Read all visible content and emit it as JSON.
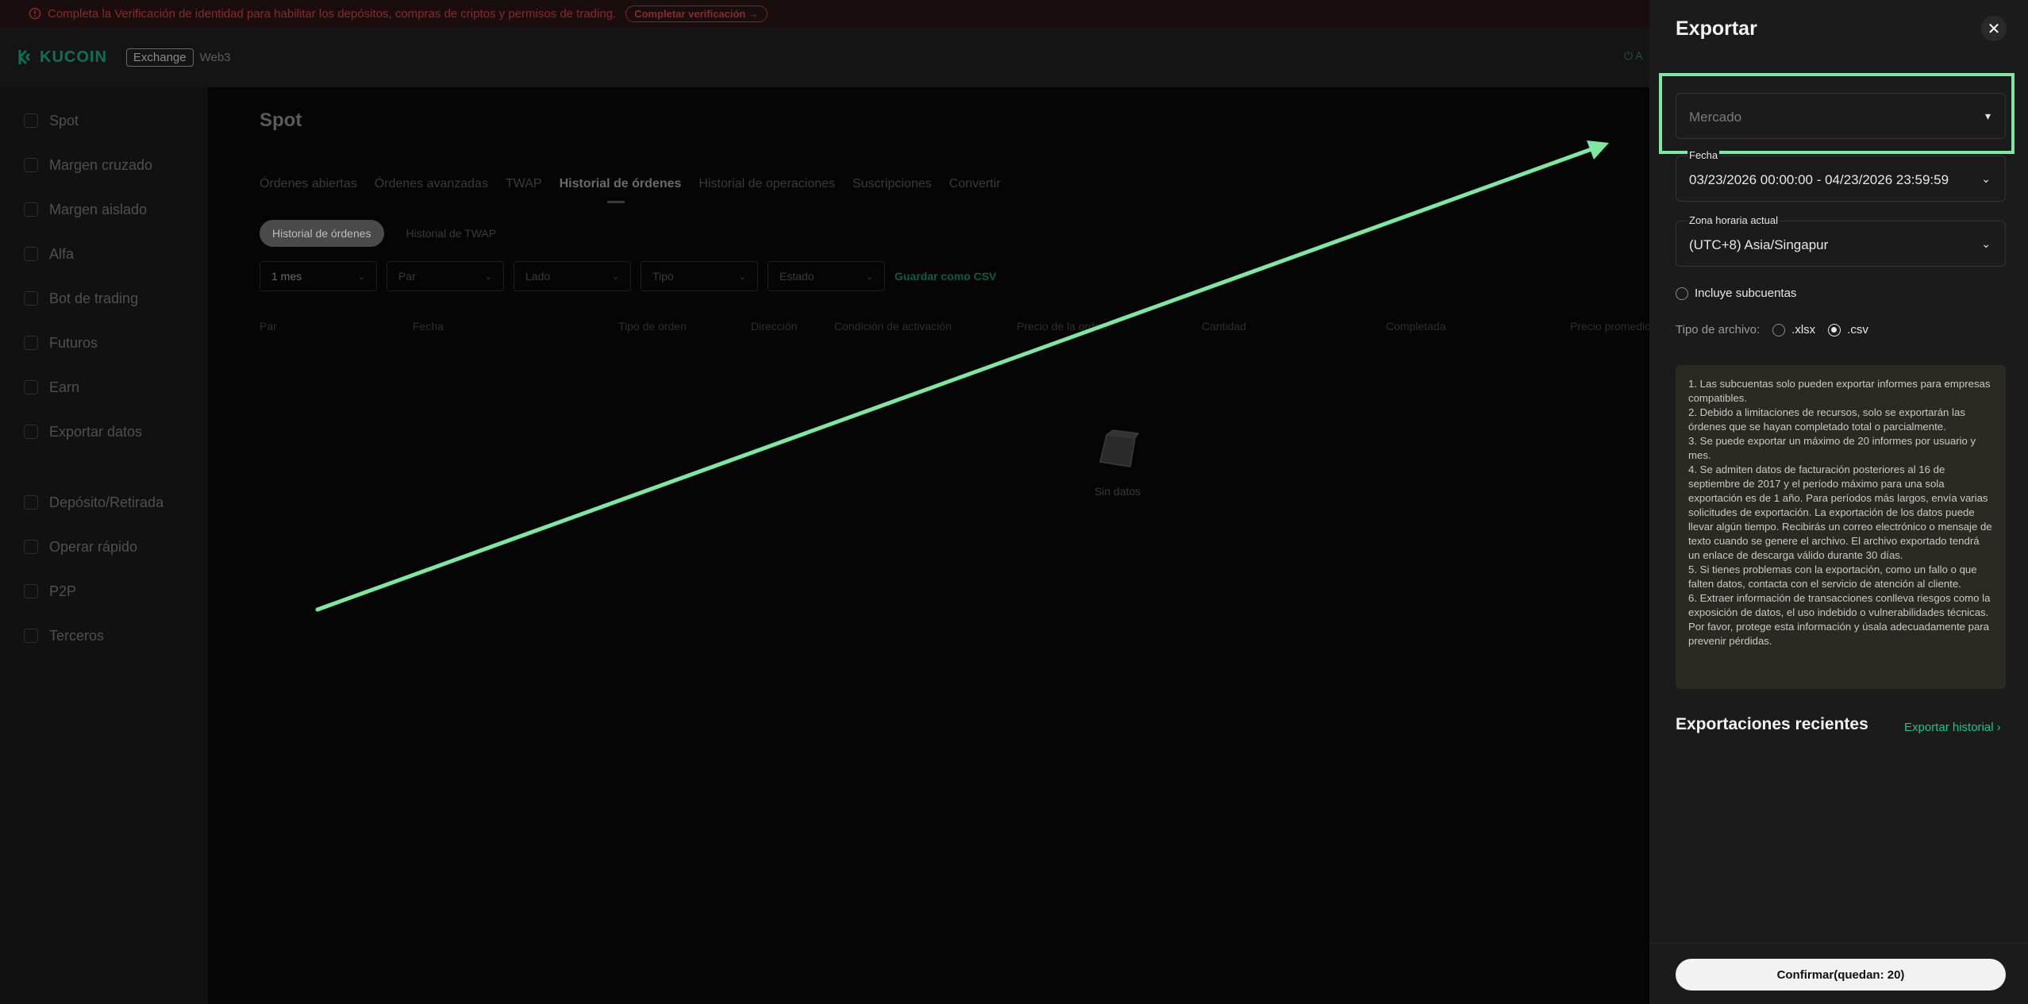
{
  "notice": {
    "text": "Completa la Verificación de identidad para habilitar los depósitos, compras de criptos y permisos de trading.",
    "button": "Completar verificación →"
  },
  "header": {
    "logo": "KUCOIN",
    "exchange": "Exchange",
    "web3": "Web3",
    "right_partial": "A"
  },
  "sidebar": {
    "items": [
      {
        "label": "Spot",
        "icon": "spot-icon"
      },
      {
        "label": "Margen cruzado",
        "icon": "margin-icon"
      },
      {
        "label": "Margen aislado",
        "icon": "isolated-icon"
      },
      {
        "label": "Alfa",
        "icon": "alpha-icon"
      },
      {
        "label": "Bot de trading",
        "icon": "bot-icon"
      },
      {
        "label": "Futuros",
        "icon": "futures-icon"
      },
      {
        "label": "Earn",
        "icon": "earn-icon"
      },
      {
        "label": "Exportar datos",
        "icon": "export-icon"
      },
      {
        "label": "Depósito/Retirada",
        "icon": "deposit-icon"
      },
      {
        "label": "Operar rápido",
        "icon": "fast-trade-icon"
      },
      {
        "label": "P2P",
        "icon": "p2p-icon"
      },
      {
        "label": "Terceros",
        "icon": "third-party-icon"
      }
    ]
  },
  "main": {
    "title": "Spot",
    "tabs": [
      {
        "label": "Órdenes abiertas"
      },
      {
        "label": "Órdenes avanzadas"
      },
      {
        "label": "TWAP"
      },
      {
        "label": "Historial de órdenes"
      },
      {
        "label": "Historial de operaciones"
      },
      {
        "label": "Suscripciones"
      },
      {
        "label": "Convertir"
      }
    ],
    "subtabs": [
      {
        "label": "Historial de órdenes"
      },
      {
        "label": "Historial de TWAP"
      }
    ],
    "filters": [
      {
        "label": "1 mes"
      },
      {
        "label": "Par"
      },
      {
        "label": "Lado"
      },
      {
        "label": "Tipo"
      },
      {
        "label": "Estado"
      }
    ],
    "save_csv": "Guardar como CSV",
    "columns": [
      {
        "label": "Par"
      },
      {
        "label": "Fecha"
      },
      {
        "label": "Tipo de orden"
      },
      {
        "label": "Dirección"
      },
      {
        "label": "Condición de activación"
      },
      {
        "label": "Precio de la orden"
      },
      {
        "label": "Cantidad"
      },
      {
        "label": "Completada"
      },
      {
        "label": "Precio promedio"
      }
    ],
    "empty_text": "Sin datos"
  },
  "panel": {
    "title": "Exportar",
    "market_placeholder": "Mercado",
    "date_label": "Fecha",
    "date_value": "03/23/2026 00:00:00 - 04/23/2026 23:59:59",
    "timezone_label": "Zona horaria actual",
    "timezone_value": "(UTC+8) Asia/Singapur",
    "include_subaccounts": "Incluye subcuentas",
    "include_subaccounts_checked": false,
    "file_type_label": "Tipo de archivo:",
    "file_types": [
      {
        "label": ".xlsx",
        "selected": false
      },
      {
        "label": ".csv",
        "selected": true
      }
    ],
    "notes": [
      "1. Las subcuentas solo pueden exportar informes para empresas compatibles.",
      "2. Debido a limitaciones de recursos, solo se exportarán las órdenes que se hayan completado total o parcialmente.",
      "3. Se puede exportar un máximo de 20 informes por usuario y mes.",
      "4. Se admiten datos de facturación posteriores al 16 de septiembre de 2017 y el período máximo para una sola exportación es de 1 año. Para períodos más largos, envía varias solicitudes de exportación. La exportación de los datos puede llevar algún tiempo. Recibirás un correo electrónico o mensaje de texto cuando se genere el archivo. El archivo exportado tendrá un enlace de descarga válido durante 30 días.",
      "5. Si tienes problemas con la exportación, como un fallo o que falten datos, contacta con el servicio de atención al cliente.",
      "6. Extraer información de transacciones conlleva riesgos como la exposición de datos, el uso indebido o vulnerabilidades técnicas. Por favor, protege esta información y úsala adecuadamente para prevenir pérdidas."
    ],
    "recent_title": "Exportaciones recientes",
    "recent_link": "Exportar historial ›",
    "confirm": "Confirmar(quedan: 20)"
  },
  "colors": {
    "accent": "#1cc48e",
    "highlight": "#7de8a0",
    "panel_bg": "#1b1b1b"
  }
}
